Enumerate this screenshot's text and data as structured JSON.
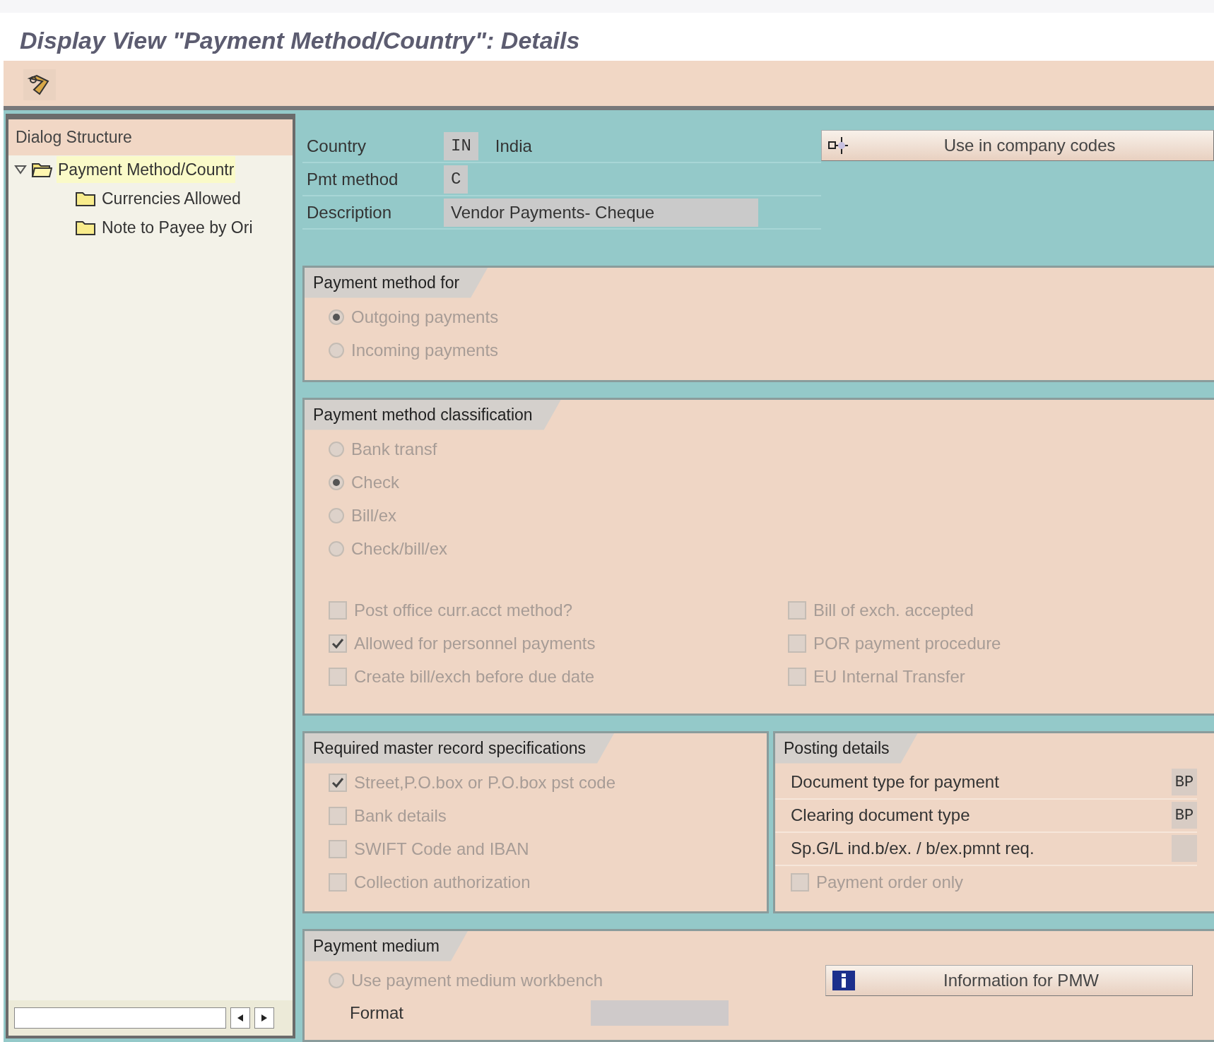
{
  "title": "Display View \"Payment Method/Country\": Details",
  "dialog_structure": {
    "title": "Dialog Structure",
    "tree": [
      {
        "label": "Payment Method/Countr",
        "expanded": true,
        "selected": true,
        "children": [
          {
            "label": "Currencies Allowed",
            "selected": false
          },
          {
            "label": "Note to Payee by Ori",
            "selected": false
          }
        ]
      }
    ]
  },
  "header": {
    "fields": [
      {
        "label": "Country",
        "value": "IN",
        "description": "India"
      },
      {
        "label": "Pmt method",
        "value": "C"
      },
      {
        "label": "Description",
        "value": "Vendor Payments- Cheque"
      }
    ],
    "button": "Use in company codes"
  },
  "payment_method_for": {
    "title": "Payment method for",
    "options": [
      {
        "label": "Outgoing payments",
        "selected": true,
        "disabled": true
      },
      {
        "label": "Incoming payments",
        "selected": false,
        "disabled": true
      }
    ]
  },
  "classification": {
    "title": "Payment method classification",
    "options": [
      {
        "label": "Bank transf",
        "selected": false,
        "disabled": true
      },
      {
        "label": "Check",
        "selected": true,
        "disabled": true
      },
      {
        "label": "Bill/ex",
        "selected": false,
        "disabled": true
      },
      {
        "label": "Check/bill/ex",
        "selected": false,
        "disabled": true
      }
    ],
    "checkboxes_left": [
      {
        "label": "Post office curr.acct method?",
        "checked": false,
        "disabled": true
      },
      {
        "label": "Allowed for personnel payments",
        "checked": true,
        "disabled": true
      },
      {
        "label": "Create bill/exch before due date",
        "checked": false,
        "disabled": true
      }
    ],
    "checkboxes_right": [
      {
        "label": "Bill of exch. accepted",
        "checked": false,
        "disabled": true
      },
      {
        "label": "POR payment procedure",
        "checked": false,
        "disabled": true
      },
      {
        "label": "EU Internal Transfer",
        "checked": false,
        "disabled": true
      }
    ]
  },
  "required_master_record": {
    "title": "Required master record specifications",
    "checkboxes": [
      {
        "label": "Street,P.O.box or P.O.box pst code",
        "checked": true,
        "disabled": true
      },
      {
        "label": "Bank details",
        "checked": false,
        "disabled": true
      },
      {
        "label": "SWIFT Code and IBAN",
        "checked": false,
        "disabled": true
      },
      {
        "label": "Collection authorization",
        "checked": false,
        "disabled": true
      }
    ]
  },
  "posting_details": {
    "title": "Posting details",
    "fields": [
      {
        "label": "Document type for payment",
        "value": "BP"
      },
      {
        "label": "Clearing document type",
        "value": "BP"
      },
      {
        "label": "Sp.G/L ind.b/ex. / b/ex.pmnt req."
      }
    ],
    "checkboxes": [
      {
        "label": "Payment order only",
        "checked": false,
        "disabled": true
      }
    ]
  },
  "payment_medium": {
    "title": "Payment medium",
    "options": [
      {
        "label": "Use payment medium workbench",
        "selected": false,
        "disabled": true
      }
    ],
    "format_label": "Format",
    "button": "Information for PMW"
  }
}
